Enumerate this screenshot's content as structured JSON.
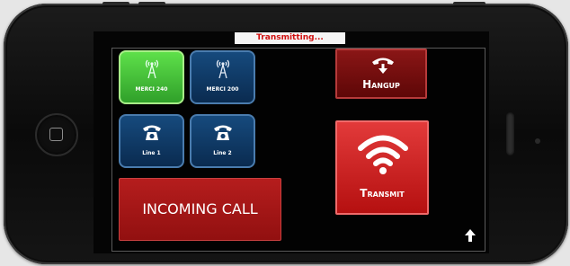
{
  "status": {
    "banner_text": "Transmitting..."
  },
  "tiles": [
    {
      "label": "MERCI 240",
      "icon": "radio-tower-icon",
      "state": "active"
    },
    {
      "label": "MERCI 200",
      "icon": "radio-tower-icon",
      "state": "inactive"
    },
    {
      "label": "Line 1",
      "icon": "telephone-icon",
      "state": "inactive"
    },
    {
      "label": "Line 2",
      "icon": "telephone-icon",
      "state": "inactive"
    }
  ],
  "buttons": {
    "hangup_label": "Hangup",
    "transmit_label": "Transmit",
    "incoming_call_label": "INCOMING CALL"
  },
  "icons": {
    "hangup": "hangup-icon",
    "transmit": "wifi-icon",
    "scroll": "arrow-up-icon"
  },
  "colors": {
    "active_tile": "#4cc83a",
    "inactive_tile": "#123d6b",
    "hangup": "#7a0e0e",
    "transmit": "#d42424",
    "incoming_call": "#a81818",
    "banner_text": "#d01010"
  }
}
